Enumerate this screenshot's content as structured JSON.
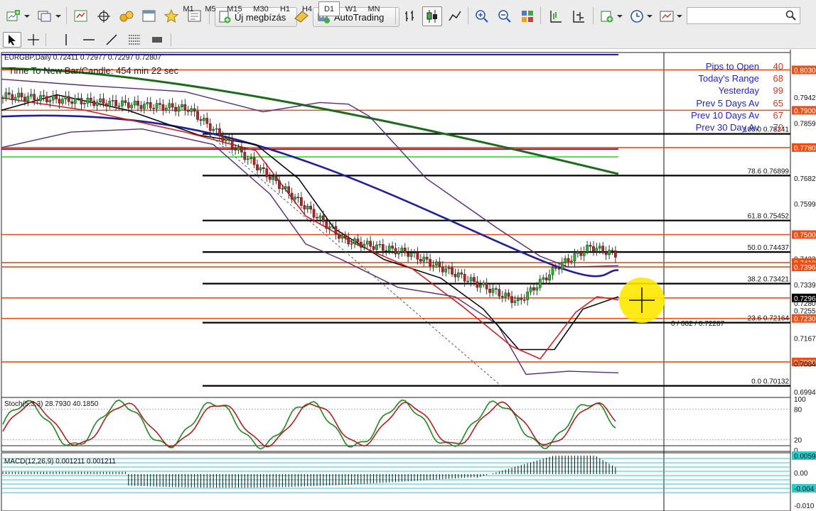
{
  "toolbar": {
    "new_order_label": "Új megbízás",
    "autotrading_label": "AutoTrading"
  },
  "timeframes": [
    "M1",
    "M5",
    "M15",
    "M30",
    "H1",
    "H4",
    "D1",
    "W1",
    "MN"
  ],
  "active_timeframe": "D1",
  "chart": {
    "symbol_header": "EURGBP,Daily  0.72411 0.72977 0.72297 0.72807",
    "countdown": "Time To New Bar/Candle: 454 min 22 sec",
    "info_rows": [
      {
        "label": "Pips to Open",
        "value": "40"
      },
      {
        "label": "Today's Range",
        "value": "68"
      },
      {
        "label": "Yesterday",
        "value": "99"
      },
      {
        "label": "Prev 5 Days Av",
        "value": "65"
      },
      {
        "label": "Prev 10 Days Av",
        "value": "67"
      },
      {
        "label": "Prev 30 Day Av",
        "value": "70"
      }
    ],
    "fib_levels": [
      {
        "label": "100.0 0.78241",
        "price": 0.78241
      },
      {
        "label": "78.6 0.76899",
        "price": 0.76899
      },
      {
        "label": "61.8 0.75452",
        "price": 0.75452
      },
      {
        "label": "50.0 0.74437",
        "price": 0.74437
      },
      {
        "label": "38.2 0.73421",
        "price": 0.73421
      },
      {
        "label": "23.6 0.72164",
        "price": 0.72164
      },
      {
        "label": "0.0 0.70132",
        "price": 0.70132
      }
    ],
    "fib_cursor_label": "0 / 682 / 0.72287",
    "price_axis": [
      "0.8030",
      "0.7942",
      "0.7900",
      "0.7859",
      "0.7780",
      "0.7682",
      "0.7599",
      "0.7500",
      "0.7422",
      "0.7410",
      "0.7396",
      "0.7339",
      "0.7296",
      "0.7280",
      "0.7255",
      "0.7230",
      "0.7167",
      "0.7090",
      "0.7084",
      "0.6994"
    ],
    "axis_colors": {
      "orange": "#e8501a",
      "black": "#000000"
    },
    "horizontal_levels": [
      {
        "price": 0.803,
        "color": "#e8501a"
      },
      {
        "price": 0.79,
        "color": "#e8501a"
      },
      {
        "price": 0.778,
        "color": "#e8501a"
      },
      {
        "price": 0.75,
        "color": "#e8501a"
      },
      {
        "price": 0.741,
        "color": "#e8501a"
      },
      {
        "price": 0.7396,
        "color": "#e8501a"
      },
      {
        "price": 0.7296,
        "color": "#e8501a"
      },
      {
        "price": 0.723,
        "color": "#e8501a"
      },
      {
        "price": 0.709,
        "color": "#e8501a"
      }
    ]
  },
  "stoch": {
    "header": "Stoch(5,3,3) 28.7930 40.1850",
    "axis": [
      "100",
      "80",
      "20",
      "0"
    ]
  },
  "macd": {
    "header": "MACD(12,26,9) 0.001211 0.001211",
    "axis": [
      "0.0059",
      "0.00",
      "-0.004",
      "-0.010"
    ]
  }
}
